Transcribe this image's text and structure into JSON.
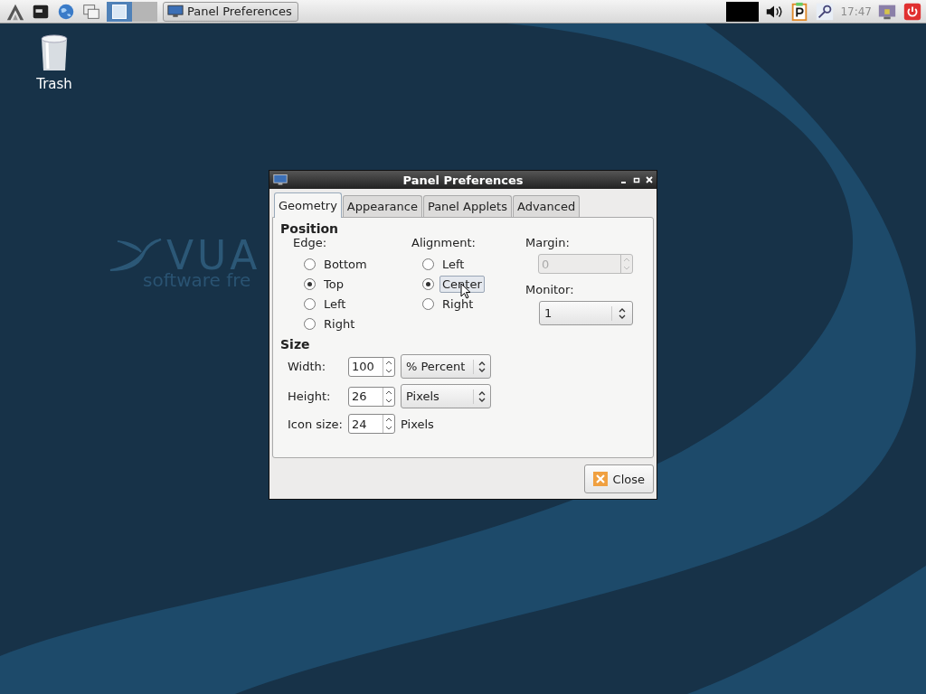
{
  "taskbar": {
    "workspaces": [
      {
        "selected": true
      },
      {
        "selected": false
      }
    ],
    "tasks": [
      {
        "title": "Panel Preferences",
        "selected": false
      }
    ],
    "clock": "17:47"
  },
  "desktop": {
    "icons": [
      {
        "label": "Trash"
      }
    ],
    "wallpaper": {
      "logo": "VUA",
      "tagline": "software fre"
    }
  },
  "dialog": {
    "title": "Panel Preferences",
    "tabs": [
      {
        "label": "Geometry",
        "selected": true
      },
      {
        "label": "Appearance",
        "selected": false
      },
      {
        "label": "Panel Applets",
        "selected": false
      },
      {
        "label": "Advanced",
        "selected": false
      }
    ],
    "position": {
      "heading": "Position",
      "edge": {
        "label": "Edge:",
        "options": [
          {
            "label": "Bottom",
            "selected": false
          },
          {
            "label": "Top",
            "selected": true
          },
          {
            "label": "Left",
            "selected": false
          },
          {
            "label": "Right",
            "selected": false
          }
        ]
      },
      "alignment": {
        "label": "Alignment:",
        "options": [
          {
            "label": "Left",
            "selected": false,
            "hovered": false
          },
          {
            "label": "Center",
            "selected": true,
            "hovered": true
          },
          {
            "label": "Right",
            "selected": false,
            "hovered": false
          }
        ]
      },
      "margin": {
        "label": "Margin:",
        "value": "0",
        "disabled": true
      },
      "monitor": {
        "label": "Monitor:",
        "value": "1"
      }
    },
    "size": {
      "heading": "Size",
      "rows": [
        {
          "label": "Width:",
          "value": "100",
          "kind": "combo",
          "unit": "% Percent"
        },
        {
          "label": "Height:",
          "value": "26",
          "kind": "combo",
          "unit": "Pixels"
        },
        {
          "label": "Icon size:",
          "value": "24",
          "kind": "label",
          "unit": "Pixels"
        }
      ]
    },
    "close_button": "Close"
  }
}
